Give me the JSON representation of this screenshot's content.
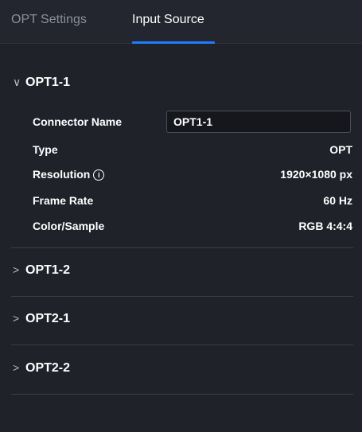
{
  "tabs": {
    "opt_settings": "OPT Settings",
    "input_source": "Input Source"
  },
  "sections": [
    {
      "title": "OPT1-1",
      "expanded_chevron": "∨",
      "connector_name_label": "Connector Name",
      "connector_name_value": "OPT1-1",
      "type_label": "Type",
      "type_value": "OPT",
      "resolution_label": "Resolution",
      "resolution_value": "1920×1080 px",
      "frame_rate_label": "Frame Rate",
      "frame_rate_value": "60 Hz",
      "color_label": "Color/Sample",
      "color_value": "RGB 4:4:4"
    },
    {
      "title": "OPT1-2",
      "chevron": ">"
    },
    {
      "title": "OPT2-1",
      "chevron": ">"
    },
    {
      "title": "OPT2-2",
      "chevron": ">"
    }
  ],
  "info_icon_glyph": "i",
  "colors": {
    "background": "#1f2229",
    "accent": "#1f7bff",
    "inactive_tab": "#8a8f99"
  }
}
